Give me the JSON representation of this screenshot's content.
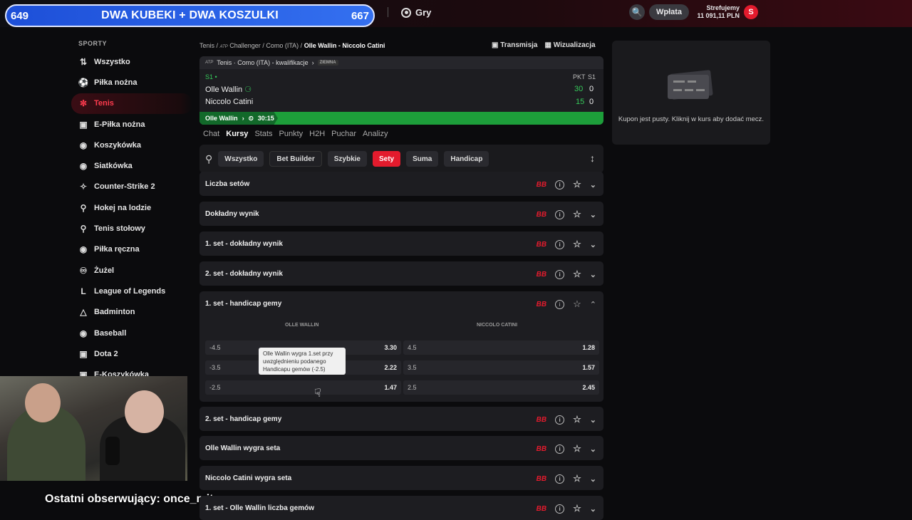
{
  "overlay": {
    "goal_left": "649",
    "goal_title": "DWA KUBEKI + DWA KOSZULKI",
    "goal_right": "667",
    "follower": "Ostatni obserwujący: once_mit"
  },
  "header": {
    "gry": "Gry",
    "wplata": "Wpłata",
    "account_name": "Strefujemy",
    "balance": "11 091,11 PLN",
    "avatar_letter": "S"
  },
  "sidebar": {
    "heading": "SPORTY",
    "items": [
      {
        "label": "Wszystko",
        "icon": "list-icon"
      },
      {
        "label": "Piłka nożna",
        "icon": "football-icon"
      },
      {
        "label": "Tenis",
        "icon": "tennis-icon",
        "active": true
      },
      {
        "label": "E-Piłka nożna",
        "icon": "gamepad-icon"
      },
      {
        "label": "Koszykówka",
        "icon": "basketball-icon"
      },
      {
        "label": "Siatkówka",
        "icon": "volleyball-icon"
      },
      {
        "label": "Counter-Strike 2",
        "icon": "cs-icon"
      },
      {
        "label": "Hokej na lodzie",
        "icon": "hockey-icon"
      },
      {
        "label": "Tenis stołowy",
        "icon": "pingpong-icon"
      },
      {
        "label": "Piłka ręczna",
        "icon": "handball-icon"
      },
      {
        "label": "Żużel",
        "icon": "speedway-icon"
      },
      {
        "label": "League of Legends",
        "icon": "lol-icon"
      },
      {
        "label": "Badminton",
        "icon": "badminton-icon"
      },
      {
        "label": "Baseball",
        "icon": "baseball-icon"
      },
      {
        "label": "Dota 2",
        "icon": "dota-icon"
      },
      {
        "label": "E-Koszykówka",
        "icon": "ebasket-icon"
      }
    ]
  },
  "breadcrumb": {
    "sport": "Tenis",
    "tour": "Challenger",
    "event": "Como (ITA)",
    "match": "Olle Wallin - Niccolo Catini"
  },
  "actions": {
    "transmisja": "Transmisja",
    "wizualizacja": "Wizualizacja"
  },
  "scoreboard": {
    "title": "Tenis · Como (ITA) - kwalifikacje",
    "surface": "ZIEMNA",
    "set_label": "S1",
    "col_pkt": "PKT",
    "col_s1": "S1",
    "player1": "Olle Wallin",
    "player1_pkt": "30",
    "player1_s1": "0",
    "player2": "Niccolo Catini",
    "player2_pkt": "15",
    "player2_s1": "0",
    "progress_player": "Olle Wallin",
    "progress_time": "30:15"
  },
  "tabs": [
    "Chat",
    "Kursy",
    "Stats",
    "Punkty",
    "H2H",
    "Puchar",
    "Analizy"
  ],
  "filters": [
    "Wszystko",
    "Bet Builder",
    "Szybkie",
    "Sety",
    "Suma",
    "Handicap"
  ],
  "bb_label": "BB",
  "markets_top": [
    "Liczba setów",
    "Dokładny wynik",
    "1. set - dokładny wynik",
    "2. set - dokładny wynik"
  ],
  "expanded": {
    "title": "1. set - handicap gemy",
    "col1": "OLLE WALLIN",
    "col2": "NICCOLO CATINI",
    "rows": [
      {
        "l1": "-4.5",
        "o1": "3.30",
        "l2": "4.5",
        "o2": "1.28"
      },
      {
        "l1": "-3.5",
        "o1": "2.22",
        "l2": "3.5",
        "o2": "1.57"
      },
      {
        "l1": "-2.5",
        "o1": "1.47",
        "l2": "2.5",
        "o2": "2.45"
      }
    ],
    "tooltip": "Olle Wallin wygra 1.set przy uwzględnieniu podanego Handicapu gemów (-2.5)"
  },
  "markets_bottom": [
    "2. set - handicap gemy",
    "Olle Wallin wygra seta",
    "Niccolo Catini wygra seta",
    "1. set - Olle Wallin liczba gemów"
  ],
  "coupon": {
    "text": "Kupon jest pusty. Kliknij w kurs aby dodać mecz."
  }
}
